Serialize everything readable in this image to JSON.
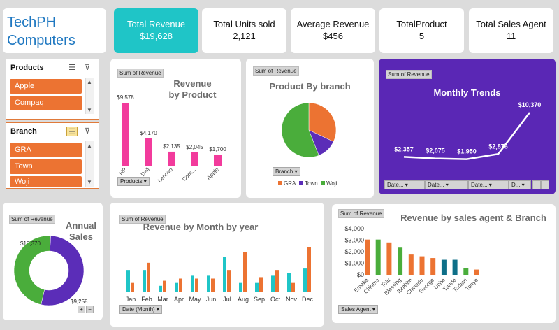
{
  "brand": {
    "line1": "TechPH",
    "line2": "Computers",
    "color": "#1f78c1"
  },
  "kpis": [
    {
      "label": "Total Revenue",
      "value": "$19,628",
      "highlight": true
    },
    {
      "label": "Total Units sold",
      "value": "2,121"
    },
    {
      "label": "Average Revenue",
      "value": "$456"
    },
    {
      "label": "TotalProduct",
      "value": "5"
    },
    {
      "label": "Total Sales Agent",
      "value": "11"
    }
  ],
  "colors": {
    "accent": "#1fc5c7",
    "orange": "#ec7332",
    "pink": "#f23b9c",
    "purple": "#5b2db8",
    "purple_bg": "#5a27b5",
    "green": "#4aad3b",
    "teal": "#0e6f88"
  },
  "slicers": {
    "products": {
      "title": "Products",
      "items": [
        "Apple",
        "Compaq"
      ]
    },
    "branch": {
      "title": "Branch",
      "items": [
        "GRA",
        "Town",
        "Woji"
      ]
    }
  },
  "pill_label": "Sum of Revenue",
  "chart_data": [
    {
      "id": "revenue_by_product",
      "type": "bar",
      "title_line1": "Revenue",
      "title_line2": "by Product",
      "categories": [
        "HP",
        "Dell",
        "Lenovo",
        "Compaq",
        "Apple"
      ],
      "tick_labels": [
        "HP",
        "Dell",
        "Lenovo",
        "Com...",
        "Apple"
      ],
      "values": [
        9578,
        4170,
        2135,
        2045,
        1700
      ],
      "data_labels": [
        "$9,578",
        "$4,170",
        "$2,135",
        "$2,045",
        "$1,700"
      ],
      "filter_button": "Products",
      "ylim": [
        0,
        9578
      ]
    },
    {
      "id": "product_by_branch",
      "type": "pie",
      "title": "Product By branch",
      "categories": [
        "GRA",
        "Town",
        "Woji"
      ],
      "values": [
        32,
        12,
        56
      ],
      "legend": "bottom",
      "filter_button": "Branch"
    },
    {
      "id": "monthly_trends",
      "type": "line",
      "title": "Monthly Trends",
      "values": [
        2357,
        2075,
        1950,
        2876,
        10370
      ],
      "data_labels": [
        "$2,357",
        "$2,075",
        "$1,950",
        "$2,876",
        "$10,370"
      ],
      "filter_buttons": [
        "Date...",
        "Date...",
        "Date...",
        "D..."
      ]
    },
    {
      "id": "annual_sales",
      "type": "pie",
      "title_line1": "Annual",
      "title_line2": "Sales",
      "values": [
        10370,
        9258
      ],
      "data_labels": [
        "$10,370",
        "$9,258"
      ]
    },
    {
      "id": "revenue_by_month_by_year",
      "type": "bar",
      "title": "Revenue by Month by year",
      "categories": [
        "Jan",
        "Feb",
        "Mar",
        "Apr",
        "May",
        "Jun",
        "Jul",
        "Aug",
        "Sep",
        "Oct",
        "Nov",
        "Dec"
      ],
      "series": [
        {
          "values": [
            30,
            30,
            8,
            12,
            22,
            22,
            48,
            12,
            12,
            22,
            26,
            32
          ]
        },
        {
          "values": [
            12,
            40,
            15,
            18,
            18,
            18,
            30,
            55,
            20,
            30,
            12,
            62
          ]
        }
      ],
      "ylim": [
        0,
        70
      ],
      "filter_button": "Date (Month)"
    },
    {
      "id": "revenue_by_agent_branch",
      "type": "bar",
      "title": "Revenue by sales agent & Branch",
      "categories": [
        "Emeka",
        "Chioma",
        "Tolu",
        "Blessing",
        "Ibrahim",
        "Chinedu",
        "George",
        "Uche",
        "Tunde",
        "Torbari",
        "Tonye"
      ],
      "values": [
        3050,
        3050,
        2800,
        2350,
        1750,
        1600,
        1450,
        1300,
        1300,
        550,
        450
      ],
      "bar_colors": [
        "orange",
        "green",
        "orange",
        "green",
        "orange",
        "orange",
        "orange",
        "teal",
        "teal",
        "green",
        "orange"
      ],
      "yticks": [
        "$0",
        "$1,000",
        "$2,000",
        "$3,000",
        "$4,000"
      ],
      "ylim": [
        0,
        4000
      ],
      "filter_button": "Sales Agent"
    }
  ],
  "misc": {
    "plus": "+",
    "minus": "−"
  }
}
